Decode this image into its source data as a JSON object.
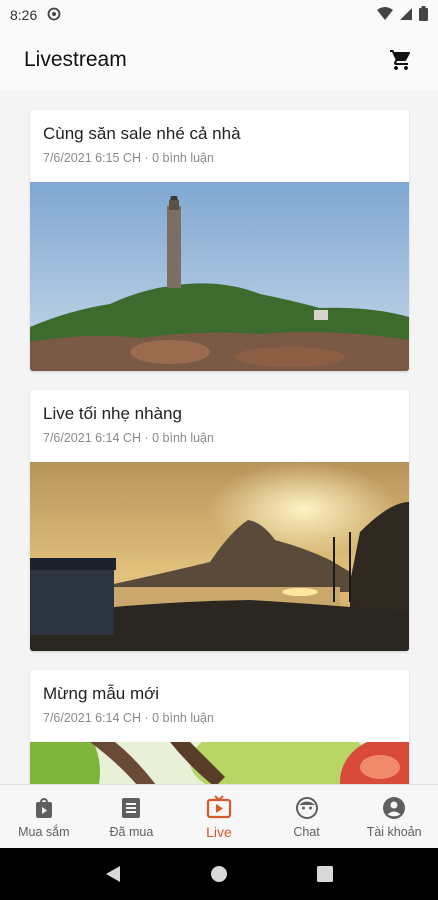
{
  "status": {
    "time": "8:26"
  },
  "app_bar": {
    "title": "Livestream"
  },
  "posts": [
    {
      "title": "Cùng săn sale nhé cả nhà",
      "meta": "7/6/2021 6:15 CH · 0 bình luận",
      "image": "lighthouse-photo"
    },
    {
      "title": "Live tối nhẹ nhàng",
      "meta": "7/6/2021 6:14 CH · 0 bình luận",
      "image": "sunset-photo"
    },
    {
      "title": "Mừng mẫu mới",
      "meta": "7/6/2021 6:14 CH · 0 bình luận",
      "image": "fruit-photo"
    }
  ],
  "bottom_nav": [
    {
      "label": "Mua sắm",
      "icon": "shopping-bag-icon"
    },
    {
      "label": "Đã mua",
      "icon": "receipt-icon"
    },
    {
      "label": "Live",
      "icon": "live-tv-icon",
      "active": true
    },
    {
      "label": "Chat",
      "icon": "chat-face-icon"
    },
    {
      "label": "Tài khoản",
      "icon": "account-icon"
    }
  ],
  "colors": {
    "accent": "#d65a2b",
    "background": "#f4f4f4"
  }
}
